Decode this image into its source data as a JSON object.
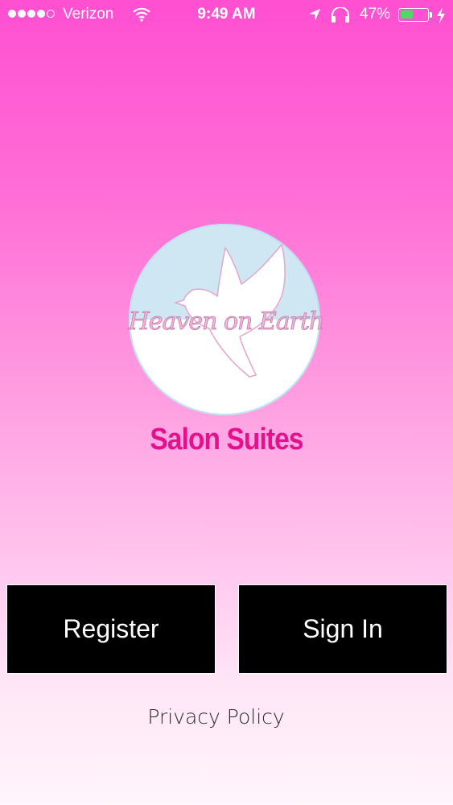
{
  "status_bar": {
    "carrier": "Verizon",
    "time": "9:49 AM",
    "battery_percent_label": "47%",
    "battery_level": 0.47,
    "signal_bars_filled": 4,
    "signal_bars_total": 5,
    "icons": [
      "signal-dots-icon",
      "wifi-icon",
      "location-arrow-icon",
      "headphones-icon",
      "battery-icon",
      "charging-bolt-icon"
    ],
    "battery_color": "#4cd964"
  },
  "logo": {
    "script_text": "Heaven on Earth",
    "icon": "dove-icon",
    "subtitle": "Salon Suites",
    "subtitle_color": "#e4118c",
    "circle_top_color": "#cfe7f2"
  },
  "actions": {
    "register_label": "Register",
    "signin_label": "Sign In",
    "privacy_label": "Privacy Policy",
    "button_color": "#000000"
  }
}
